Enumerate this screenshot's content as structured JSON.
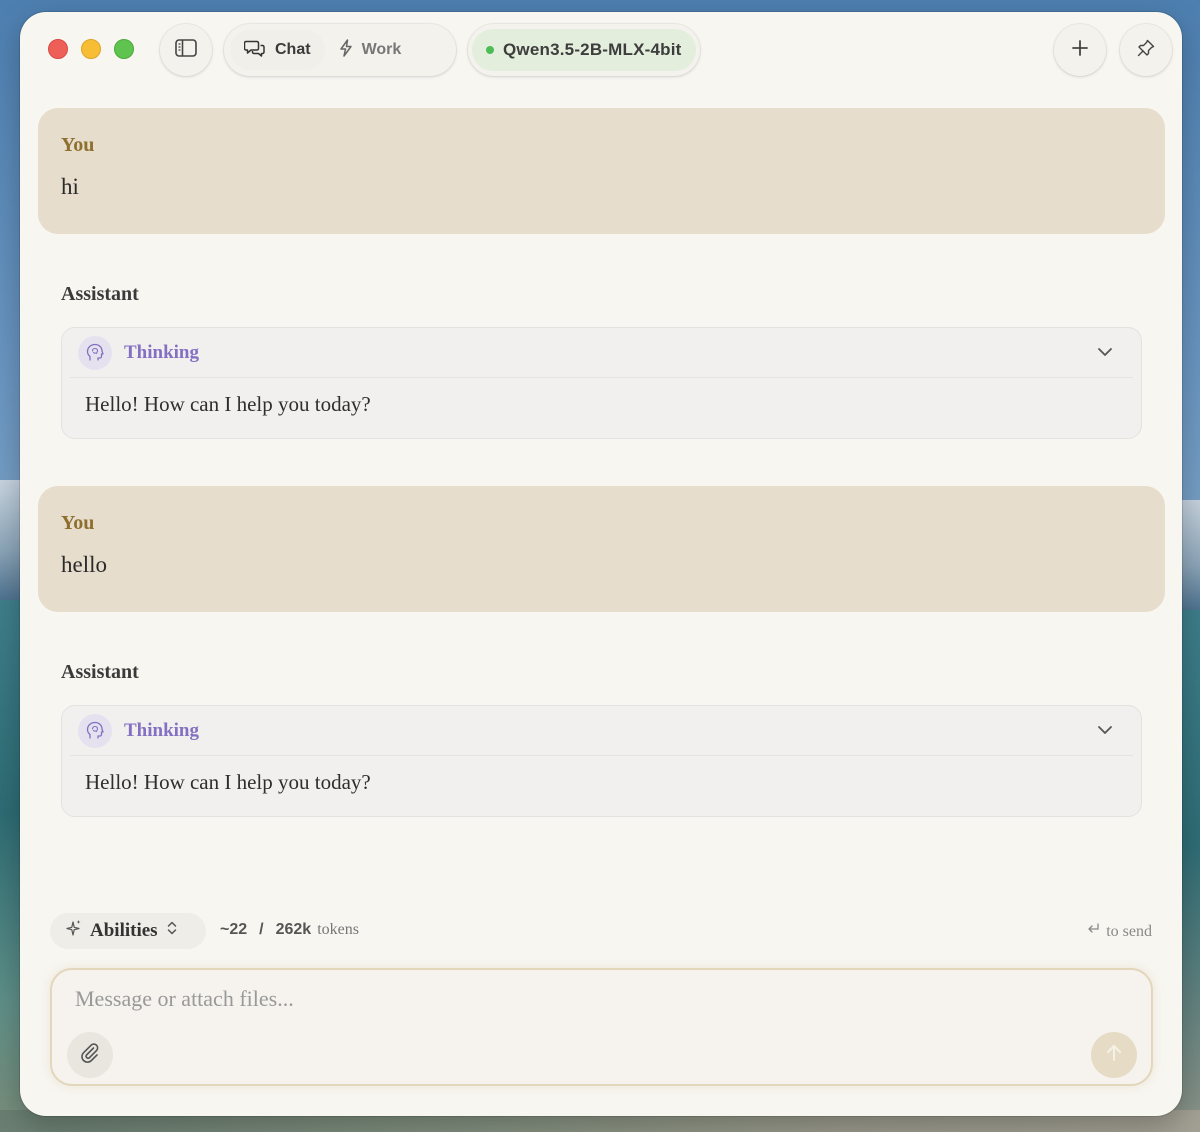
{
  "toolbar": {
    "modes": [
      {
        "label": "Chat",
        "icon": "chat-bubbles-icon",
        "active": true
      },
      {
        "label": "Work",
        "icon": "lightning-icon",
        "active": false
      }
    ],
    "model": {
      "name": "Qwen3.5-2B-MLX-4bit",
      "status_color": "#4cbc55"
    }
  },
  "messages": [
    {
      "role": "user",
      "label": "You",
      "text": "hi"
    },
    {
      "role": "assistant",
      "label": "Assistant",
      "thinking_label": "Thinking",
      "text": "Hello! How can I help you today?"
    },
    {
      "role": "user",
      "label": "You",
      "text": "hello"
    },
    {
      "role": "assistant",
      "label": "Assistant",
      "thinking_label": "Thinking",
      "text": "Hello! How can I help you today?"
    }
  ],
  "footer": {
    "abilities_label": "Abilities",
    "tokens_used": "~22",
    "tokens_separator": "/",
    "tokens_max": "262k",
    "tokens_unit": "tokens",
    "send_hint": "to send"
  },
  "composer": {
    "placeholder": "Message or attach files...",
    "value": ""
  },
  "colors": {
    "user_bubble": "#e6ddcc",
    "user_label": "#8e6f2e",
    "thinking_label": "#8470c2",
    "model_pill": "#e3eedd"
  }
}
